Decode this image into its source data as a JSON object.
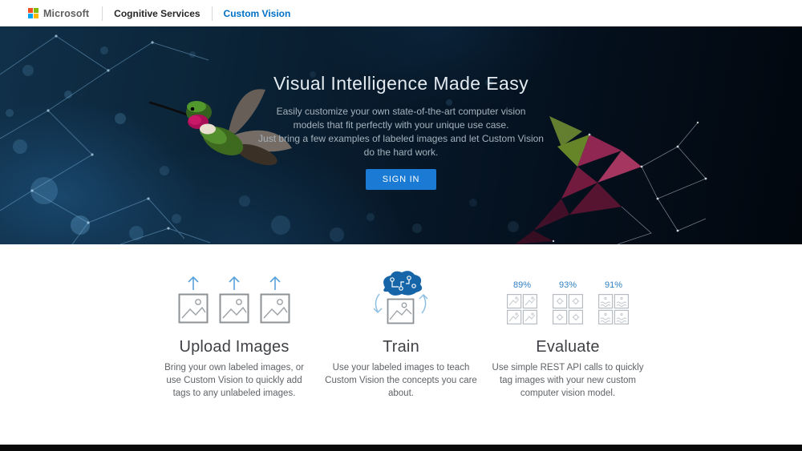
{
  "nav": {
    "brand": "Microsoft",
    "items": [
      {
        "label": "Cognitive Services"
      },
      {
        "label": "Custom Vision"
      }
    ]
  },
  "hero": {
    "title": "Visual Intelligence Made Easy",
    "lines": [
      "Easily customize your own state-of-the-art computer vision",
      "models that fit perfectly with your unique use case.",
      "Just bring a few examples of labeled images and let Custom Vision",
      "do the hard work."
    ],
    "sign_in_label": "SIGN IN"
  },
  "features": [
    {
      "title": "Upload Images",
      "description": "Bring your own labeled images, or use Custom Vision to quickly add tags to any unlabeled images.",
      "icon": "upload-images-icon"
    },
    {
      "title": "Train",
      "description": "Use your labeled images to teach Custom Vision the concepts you care about.",
      "icon": "train-brain-icon"
    },
    {
      "title": "Evaluate",
      "description": "Use simple REST API calls to quickly tag images with your new custom computer vision model.",
      "icon": "evaluate-icon",
      "percentages": [
        "89%",
        "93%",
        "91%"
      ]
    }
  ],
  "colors": {
    "nav_accent": "#0071c5",
    "signin_button": "#1b7bd4",
    "percent_blue": "#2e7fc2",
    "hero_background": "#061626",
    "ms_logo": [
      "#f25022",
      "#7fba00",
      "#00a4ef",
      "#ffb900"
    ]
  }
}
